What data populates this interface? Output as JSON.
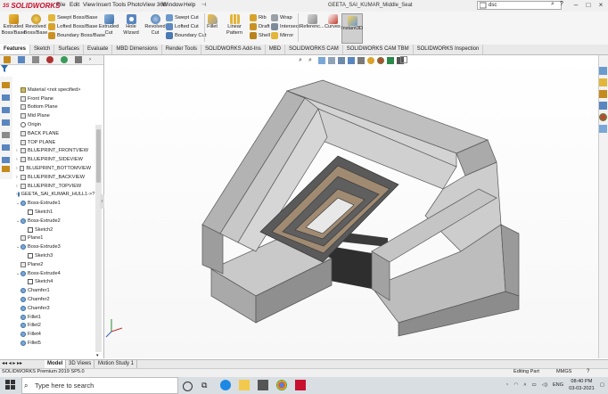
{
  "app": {
    "name": "SOLIDWORKS",
    "document_title": "GEETA_SAI_KUMAR_Middle_Seat",
    "search_placeholder": "dsc"
  },
  "menu": [
    "File",
    "Edit",
    "View",
    "Insert",
    "Tools",
    "PhotoView 360",
    "Window",
    "Help"
  ],
  "ribbon": {
    "extruded_boss": [
      "Extruded",
      "Boss/Base"
    ],
    "revolved_boss": [
      "Revolved",
      "Boss/Base"
    ],
    "swept_boss": "Swept Boss/Base",
    "lofted_boss": "Lofted Boss/Base",
    "boundary_boss": "Boundary Boss/Base",
    "extruded_cut": [
      "Extruded",
      "Cut"
    ],
    "hole_wizard": "Hole Wizard",
    "revolved_cut": [
      "Revolved",
      "Cut"
    ],
    "swept_cut": "Swept Cut",
    "lofted_cut": "Lofted Cut",
    "boundary_cut": "Boundary Cut",
    "fillet": "Fillet",
    "linear_pattern": "Linear Pattern",
    "rib": "Rib",
    "draft": "Draft",
    "shell": "Shell",
    "wrap": "Wrap",
    "intersect": "Intersect",
    "mirror": "Mirror",
    "reference": "Referenc...",
    "curves": "Curves",
    "instant3d": "Instant3D"
  },
  "command_tabs": [
    "Features",
    "Sketch",
    "Surfaces",
    "Evaluate",
    "MBD Dimensions",
    "Render Tools",
    "SOLIDWORKS Add-Ins",
    "MBD",
    "SOLIDWORKS CAM",
    "SOLIDWORKS CAM TBM",
    "SOLIDWORKS Inspection"
  ],
  "tree": [
    {
      "label": "Material <not specified>",
      "icon": "mat",
      "indent": 0,
      "arrow": ""
    },
    {
      "label": "Front Plane",
      "icon": "plane",
      "indent": 0,
      "arrow": ""
    },
    {
      "label": "Bottom Plane",
      "icon": "plane",
      "indent": 0,
      "arrow": ""
    },
    {
      "label": "Mid Plane",
      "icon": "plane",
      "indent": 0,
      "arrow": ""
    },
    {
      "label": "Origin",
      "icon": "origin",
      "indent": 0,
      "arrow": ""
    },
    {
      "label": "BACK PLANE",
      "icon": "plane",
      "indent": 0,
      "arrow": ""
    },
    {
      "label": "TOP PLANE",
      "icon": "plane",
      "indent": 0,
      "arrow": ""
    },
    {
      "label": "BLUEPRINT_FRONTVIEW",
      "icon": "plane",
      "indent": 0,
      "arrow": "›"
    },
    {
      "label": "BLUEPRINT_SIDEVIEW",
      "icon": "plane",
      "indent": 0,
      "arrow": "›"
    },
    {
      "label": "BLUEPRINT_BOTTOMVIEW",
      "icon": "plane",
      "indent": 0,
      "arrow": "›"
    },
    {
      "label": "BLUEPRINT_BACKVIEW",
      "icon": "plane",
      "indent": 0,
      "arrow": "›"
    },
    {
      "label": "BLUEPRINT_TOPVIEW",
      "icon": "plane",
      "indent": 0,
      "arrow": "›"
    },
    {
      "label": "GEETA_SAI_KUMAR_HULL1->?",
      "icon": "feat",
      "indent": 0,
      "arrow": "›"
    },
    {
      "label": "Boss-Extrude1",
      "icon": "feat",
      "indent": 0,
      "arrow": "⌄"
    },
    {
      "label": "Sketch1",
      "icon": "sketch",
      "indent": 1,
      "arrow": ""
    },
    {
      "label": "Boss-Extrude2",
      "icon": "feat",
      "indent": 0,
      "arrow": "⌄"
    },
    {
      "label": "Sketch2",
      "icon": "sketch",
      "indent": 1,
      "arrow": ""
    },
    {
      "label": "Plane1",
      "icon": "plane",
      "indent": 0,
      "arrow": ""
    },
    {
      "label": "Boss-Extrude3",
      "icon": "feat",
      "indent": 0,
      "arrow": "⌄"
    },
    {
      "label": "Sketch3",
      "icon": "sketch",
      "indent": 1,
      "arrow": ""
    },
    {
      "label": "Plane2",
      "icon": "plane",
      "indent": 0,
      "arrow": ""
    },
    {
      "label": "Boss-Extrude4",
      "icon": "feat",
      "indent": 0,
      "arrow": "⌄"
    },
    {
      "label": "Sketch4",
      "icon": "sketch",
      "indent": 1,
      "arrow": ""
    },
    {
      "label": "Chamfer1",
      "icon": "feat",
      "indent": 0,
      "arrow": ""
    },
    {
      "label": "Chamfer2",
      "icon": "feat",
      "indent": 0,
      "arrow": ""
    },
    {
      "label": "Chamfer3",
      "icon": "feat",
      "indent": 0,
      "arrow": ""
    },
    {
      "label": "Fillet1",
      "icon": "feat",
      "indent": 0,
      "arrow": ""
    },
    {
      "label": "Fillet2",
      "icon": "feat",
      "indent": 0,
      "arrow": ""
    },
    {
      "label": "Fillet4",
      "icon": "feat",
      "indent": 0,
      "arrow": ""
    },
    {
      "label": "Fillet5",
      "icon": "feat",
      "indent": 0,
      "arrow": ""
    }
  ],
  "bottom_tabs": [
    "Model",
    "3D Views",
    "Motion Study 1"
  ],
  "status": {
    "left": "SOLIDWORKS Premium 2019 SP5.0",
    "mode": "Editing Part",
    "units": "MMGS"
  },
  "taskbar": {
    "search_placeholder": "Type here to search",
    "language": "ENG",
    "time": "08:40 PM",
    "date": "03-03-2021"
  },
  "colors": {
    "brand": "#c8102e",
    "seat": "#b9b9b9",
    "table_top": "#5a5a5a",
    "table_frame": "#a08a72"
  }
}
